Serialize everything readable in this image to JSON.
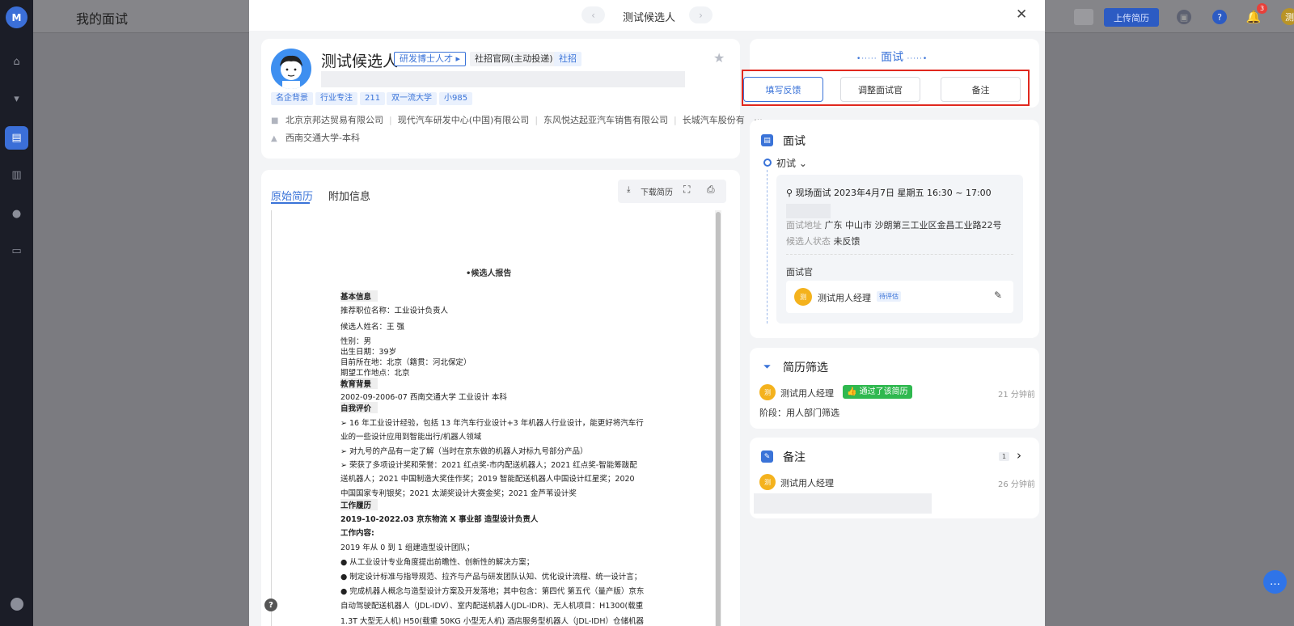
{
  "app": {
    "title": "我的面试",
    "upload_label": "上传简历",
    "notification_count": "3",
    "user_initial": "测",
    "help_label": "?"
  },
  "modal": {
    "title": "测试候选人",
    "prev_icon": "chevron-left-icon",
    "next_icon": "chevron-right-icon",
    "close_label": "✕"
  },
  "profile": {
    "name": "测试候选人",
    "tags": [
      {
        "label": "研发博士人才"
      },
      {
        "label": "社招官网(主动投递)"
      },
      {
        "label": "社招"
      }
    ],
    "small_tags": [
      "名企背景",
      "行业专注",
      "211",
      "双一流大学",
      "小985"
    ],
    "companies": [
      "北京京邦达贸易有限公司",
      "现代汽车研发中心(中国)有限公司",
      "东风悦达起亚汽车销售有限公司",
      "长城汽车股份有"
    ],
    "more": "···",
    "education": "西南交通大学-本科"
  },
  "resume": {
    "tabs": [
      "原始简历",
      "附加信息"
    ],
    "download_label": "下载简历",
    "title": "•候选人报告",
    "lines": [
      {
        "text": "基本信息",
        "h": true
      },
      {
        "text": "推荐职位名称：工业设计负责人"
      },
      {
        "text": "候选人姓名：王  强"
      },
      {
        "text": "性别：男"
      },
      {
        "text": "出生日期：39岁"
      },
      {
        "text": "目前所在地：北京（籍贯：河北保定）"
      },
      {
        "text": "期望工作地点：北京"
      },
      {
        "text": "教育背景",
        "h": true
      },
      {
        "text": "2002-09-2006-07      西南交通大学        工业设计              本科"
      },
      {
        "text": "自我评价",
        "h": true
      },
      {
        "text": "➢   16 年工业设计经验，包括 13 年汽车行业设计+3 年机器人行业设计，能更好将汽车行"
      },
      {
        "text": "      业的一些设计应用到智能出行/机器人领域"
      },
      {
        "text": "➢   对九号的产品有一定了解（当时在京东做的机器人对标九号部分产品）"
      },
      {
        "text": "➢   荣获了多项设计奖和荣誉：2021 红点奖-市内配送机器人；2021 红点奖-智能筹跋配"
      },
      {
        "text": "      送机器人；2021 中国制造大奖佳作奖；2019 智能配送机器人中国设计红星奖；2020"
      },
      {
        "text": "      中国国家专利银奖；2021 太湖奖设计大赛金奖；2021 金芦苇设计奖"
      },
      {
        "text": "工作履历",
        "h": true
      },
      {
        "text": "2019-10-2022.03       京东物流 X 事业部          造型设计负责人",
        "b": true
      },
      {
        "text": "工作内容:",
        "b": true
      },
      {
        "text": "2019  年从  0  到  1  组建造型设计团队；"
      },
      {
        "text": "●  从工业设计专业角度提出前瞻性、创新性的解决方案；"
      },
      {
        "text": "●  制定设计标准与指导规范、拉齐与产品与研发团队认知、优化设计流程、统一设计言；"
      },
      {
        "text": "●  完成机器人概念与造型设计方案及开发落地；其中包含：第四代  第五代（量产版）京东"
      },
      {
        "text": "自动驾驶配送机器人（JDL-IDV）、室内配送机器人(JDL-IDR)、无人机项目：H1300(载重"
      },
      {
        "text": "1.3T  大型无人机) H50(载重  50KG  小型无人机)  酒店服务型机器人（JDL-IDH）仓储机器"
      },
      {
        "text": "人（举升  AGV  无人物流牵引机  全生  AMR）"
      }
    ]
  },
  "interview_panel": {
    "header": "面试",
    "buttons": [
      "填写反馈",
      "调整面试官",
      "备注"
    ]
  },
  "interview": {
    "title": "面试",
    "round": "初试",
    "location_line": "现场面试 2023年4月7日 星期五 16:30 ~ 17:00",
    "address_label": "面试地址",
    "address": "广东 中山市 沙朗第三工业区金昌工业路22号",
    "status_label": "候选人状态",
    "status": "未反馈",
    "interviewer_label": "面试官",
    "interviewer_name": "测试用人经理",
    "interviewer_state": "待评估",
    "avatar_initial": "测"
  },
  "screening": {
    "title": "简历筛选",
    "user": "测试用人经理",
    "result": "通过了该简历",
    "time": "21 分钟前",
    "stage": "阶段：用人部门筛选",
    "avatar_initial": "测"
  },
  "notes": {
    "title": "备注",
    "count": "1",
    "user": "测试用人经理",
    "time": "26 分钟前",
    "avatar_initial": "测"
  }
}
